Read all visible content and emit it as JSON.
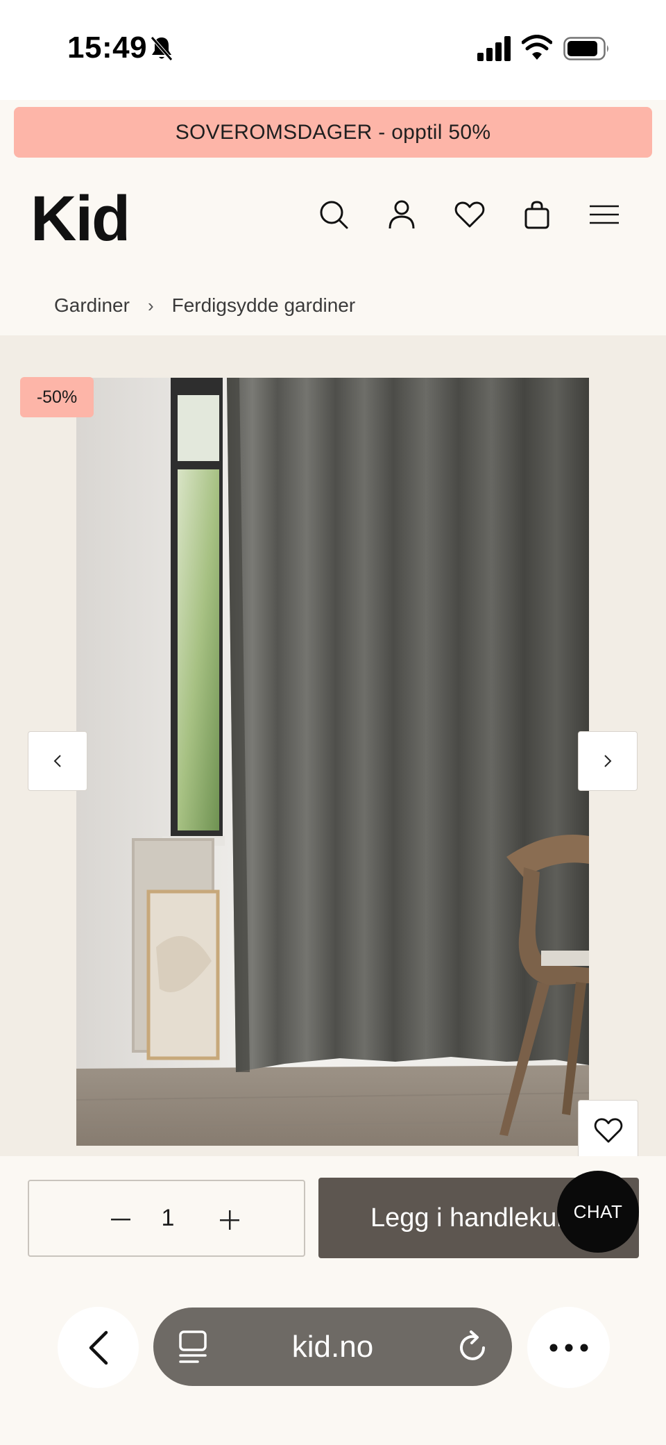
{
  "status_bar": {
    "time": "15:49",
    "icons": [
      "bell-off-icon",
      "cellular-signal-icon",
      "wifi-icon",
      "battery-icon"
    ]
  },
  "promo_banner": {
    "text": "SOVEROMSDAGER - opptil 50%",
    "color": "#fdb5a8"
  },
  "header": {
    "logo": "Kid",
    "icons": [
      "search-icon",
      "account-icon",
      "heart-icon",
      "shopping-bag-icon",
      "menu-icon"
    ]
  },
  "breadcrumb": {
    "items": [
      "Gardiner",
      "Ferdigsydde gardiner"
    ]
  },
  "product": {
    "discount_badge": "-50%",
    "gallery_controls": [
      "chevron-left-icon",
      "chevron-right-icon",
      "heart-icon"
    ]
  },
  "cart": {
    "quantity": "1",
    "add_to_cart_label": "Legg i handlekurv",
    "button_color": "#5d5650"
  },
  "chat": {
    "label": "CHAT"
  },
  "browser": {
    "url": "kid.no",
    "icons": [
      "back-icon",
      "tabs-icon",
      "reload-icon",
      "more-icon"
    ]
  }
}
